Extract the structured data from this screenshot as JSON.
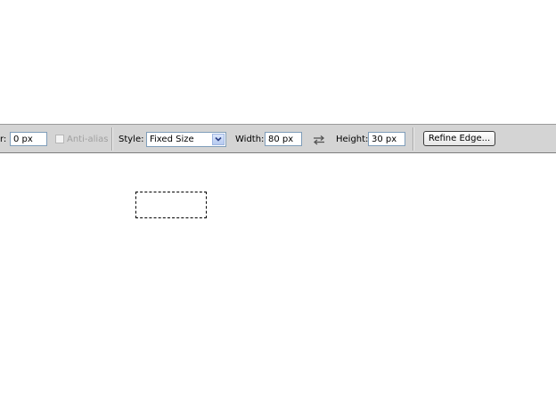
{
  "toolbar": {
    "feather_label_tail": "r:",
    "feather_value": "0 px",
    "antialias_label": "Anti-alias",
    "style_label": "Style:",
    "style_value": "Fixed Size",
    "width_label": "Width:",
    "width_value": "80 px",
    "height_label": "Height:",
    "height_value": "30 px",
    "refine_edge_label": "Refine Edge..."
  },
  "icons": {
    "swap": "swap-arrows-icon",
    "dropdown": "chevron-down-icon"
  },
  "colors": {
    "toolbar_bg": "#d4d4d4",
    "canvas_bg": "#ffffff",
    "input_border": "#7f9db9"
  }
}
